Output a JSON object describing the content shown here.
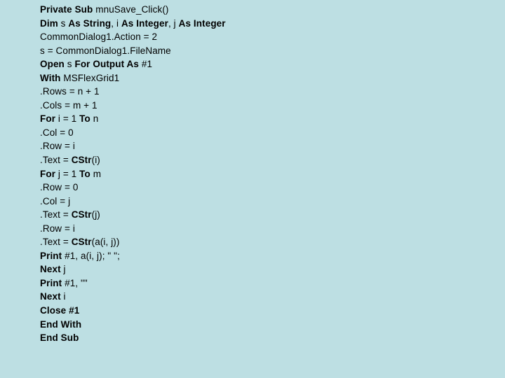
{
  "document": {
    "kind": "source-code-listing",
    "language": "Visual Basic",
    "background_color": "#bddfe3",
    "text_color": "#000000",
    "lines": [
      {
        "index": 1,
        "text": "Private Sub mnuSave_Click()",
        "tokens": [
          {
            "t": "Private Sub",
            "b": true
          },
          {
            "t": " mnuSave_Click()",
            "b": false
          }
        ]
      },
      {
        "index": 2,
        "text": "Dim s As String, i As Integer, j As Integer",
        "tokens": [
          {
            "t": "Dim",
            "b": true
          },
          {
            "t": " s ",
            "b": false
          },
          {
            "t": "As String",
            "b": true
          },
          {
            "t": ", i ",
            "b": false
          },
          {
            "t": "As Integer",
            "b": true
          },
          {
            "t": ", j ",
            "b": false
          },
          {
            "t": "As Integer",
            "b": true
          }
        ]
      },
      {
        "index": 3,
        "text": "CommonDialog1.Action = 2",
        "tokens": [
          {
            "t": "CommonDialog1.Action = 2",
            "b": false
          }
        ]
      },
      {
        "index": 4,
        "text": "s = CommonDialog1.FileName",
        "tokens": [
          {
            "t": "s = CommonDialog1.FileName",
            "b": false
          }
        ]
      },
      {
        "index": 5,
        "text": "Open s For Output As #1",
        "tokens": [
          {
            "t": "Open",
            "b": true
          },
          {
            "t": " s ",
            "b": false
          },
          {
            "t": "For Output As",
            "b": true
          },
          {
            "t": " #1",
            "b": false
          }
        ]
      },
      {
        "index": 6,
        "text": "With MSFlexGrid1",
        "tokens": [
          {
            "t": "With",
            "b": true
          },
          {
            "t": " MSFlexGrid1",
            "b": false
          }
        ]
      },
      {
        "index": 7,
        "text": ".Rows = n + 1",
        "tokens": [
          {
            "t": ".Rows = n + 1",
            "b": false
          }
        ]
      },
      {
        "index": 8,
        "text": ".Cols = m + 1",
        "tokens": [
          {
            "t": ".Cols = m + 1",
            "b": false
          }
        ]
      },
      {
        "index": 9,
        "text": "For i = 1 To n",
        "tokens": [
          {
            "t": "For",
            "b": true
          },
          {
            "t": " i = 1 ",
            "b": false
          },
          {
            "t": "To",
            "b": true
          },
          {
            "t": " n",
            "b": false
          }
        ]
      },
      {
        "index": 10,
        "text": ".Col = 0",
        "tokens": [
          {
            "t": ".Col = 0",
            "b": false
          }
        ]
      },
      {
        "index": 11,
        "text": ".Row = i",
        "tokens": [
          {
            "t": ".Row = i",
            "b": false
          }
        ]
      },
      {
        "index": 12,
        "text": ".Text = CStr(i)",
        "tokens": [
          {
            "t": ".Text = ",
            "b": false
          },
          {
            "t": "CStr",
            "b": true
          },
          {
            "t": "(i)",
            "b": false
          }
        ]
      },
      {
        "index": 13,
        "text": "For j = 1 To m",
        "tokens": [
          {
            "t": "For",
            "b": true
          },
          {
            "t": " j = 1 ",
            "b": false
          },
          {
            "t": "To",
            "b": true
          },
          {
            "t": " m",
            "b": false
          }
        ]
      },
      {
        "index": 14,
        "text": ".Row = 0",
        "tokens": [
          {
            "t": ".Row = 0",
            "b": false
          }
        ]
      },
      {
        "index": 15,
        "text": ".Col = j",
        "tokens": [
          {
            "t": ".Col = j",
            "b": false
          }
        ]
      },
      {
        "index": 16,
        "text": ".Text = CStr(j)",
        "tokens": [
          {
            "t": ".Text = ",
            "b": false
          },
          {
            "t": "CStr",
            "b": true
          },
          {
            "t": "(j)",
            "b": false
          }
        ]
      },
      {
        "index": 17,
        "text": ".Row = i",
        "tokens": [
          {
            "t": ".Row = i",
            "b": false
          }
        ]
      },
      {
        "index": 18,
        "text": ".Text = CStr(a(i, j))",
        "tokens": [
          {
            "t": ".Text = ",
            "b": false
          },
          {
            "t": "CStr",
            "b": true
          },
          {
            "t": "(a(i, j))",
            "b": false
          }
        ]
      },
      {
        "index": 19,
        "text": "Print #1, a(i, j); \" \";",
        "tokens": [
          {
            "t": "Print",
            "b": true
          },
          {
            "t": " #1, a(i, j); \" \";",
            "b": false
          }
        ]
      },
      {
        "index": 20,
        "text": "Next j",
        "tokens": [
          {
            "t": "Next",
            "b": true
          },
          {
            "t": " j",
            "b": false
          }
        ]
      },
      {
        "index": 21,
        "text": "Print #1, \"\"",
        "tokens": [
          {
            "t": "Print",
            "b": true
          },
          {
            "t": " #1, \"\"",
            "b": false
          }
        ]
      },
      {
        "index": 22,
        "text": "Next i",
        "tokens": [
          {
            "t": "Next",
            "b": true
          },
          {
            "t": " i",
            "b": false
          }
        ]
      },
      {
        "index": 23,
        "text": "Close #1",
        "tokens": [
          {
            "t": "Close #1",
            "b": true
          }
        ]
      },
      {
        "index": 24,
        "text": "End With",
        "tokens": [
          {
            "t": "End With",
            "b": true
          }
        ]
      },
      {
        "index": 25,
        "text": "End Sub",
        "tokens": [
          {
            "t": "End Sub",
            "b": true
          }
        ]
      }
    ]
  }
}
